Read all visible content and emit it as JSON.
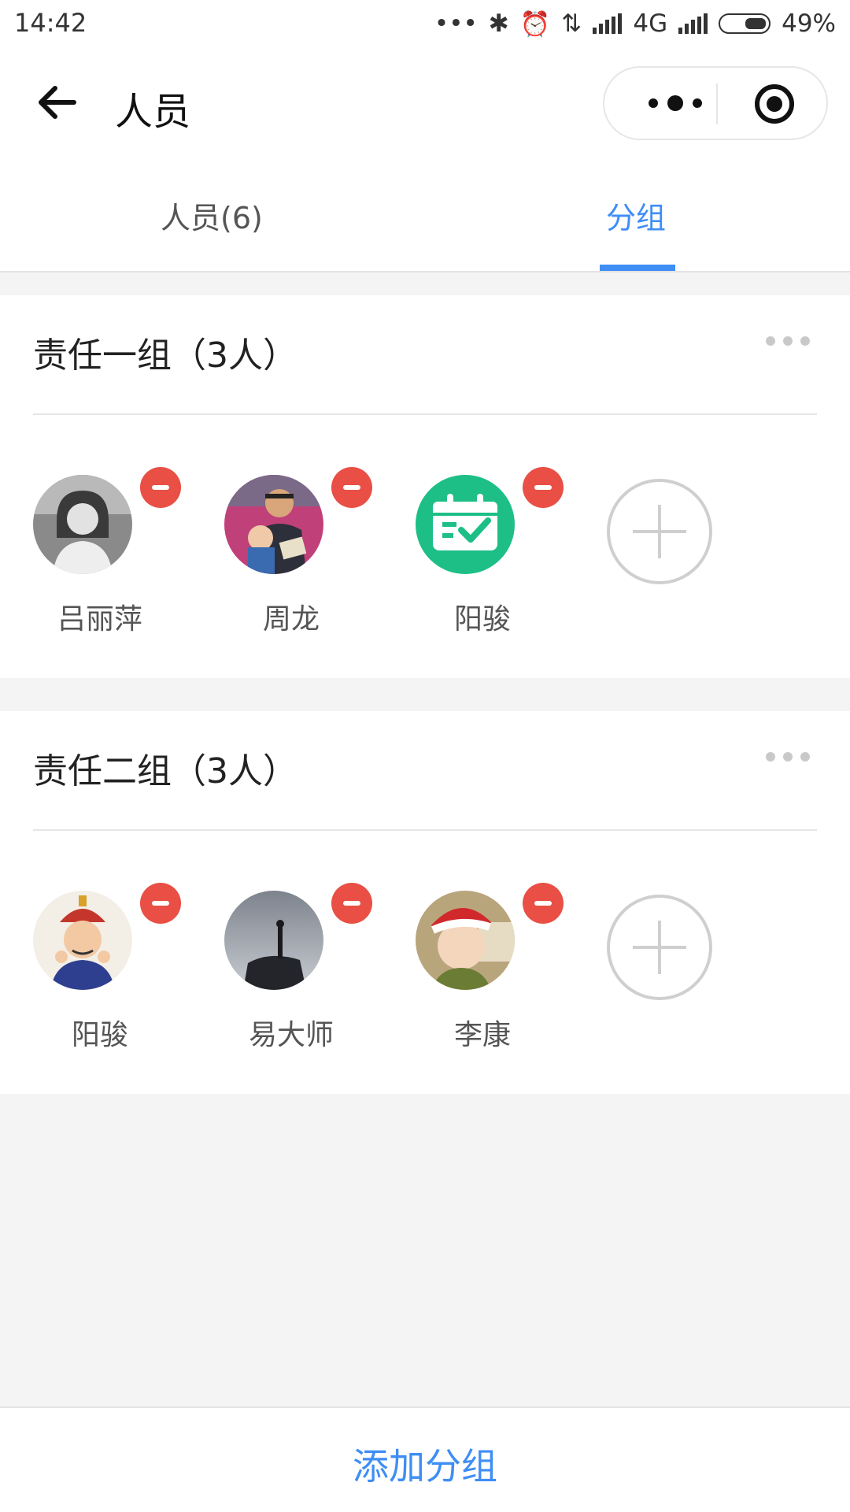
{
  "status_bar": {
    "time": "14:42",
    "network": "4G",
    "battery": "49%"
  },
  "nav": {
    "title": "人员"
  },
  "tabs": [
    {
      "label": "人员(6)",
      "active": false
    },
    {
      "label": "分组",
      "active": true
    }
  ],
  "groups": [
    {
      "title": "责任一组（3人）",
      "members": [
        {
          "name": "吕丽萍",
          "avatar": "grayscale-girl-photo"
        },
        {
          "name": "周龙",
          "avatar": "man-with-baby-photo"
        },
        {
          "name": "阳骏",
          "avatar": "calendar-check-icon"
        }
      ]
    },
    {
      "title": "责任二组（3人）",
      "members": [
        {
          "name": "阳骏",
          "avatar": "qing-official-cartoon-photo"
        },
        {
          "name": "易大师",
          "avatar": "silhouette-on-rock-photo"
        },
        {
          "name": "李康",
          "avatar": "child-with-santa-hat-photo"
        }
      ]
    }
  ],
  "footer": {
    "add_group_label": "添加分组"
  },
  "colors": {
    "accent": "#3f8ef5",
    "remove": "#e94f45",
    "calendar_green": "#1dbf87"
  }
}
